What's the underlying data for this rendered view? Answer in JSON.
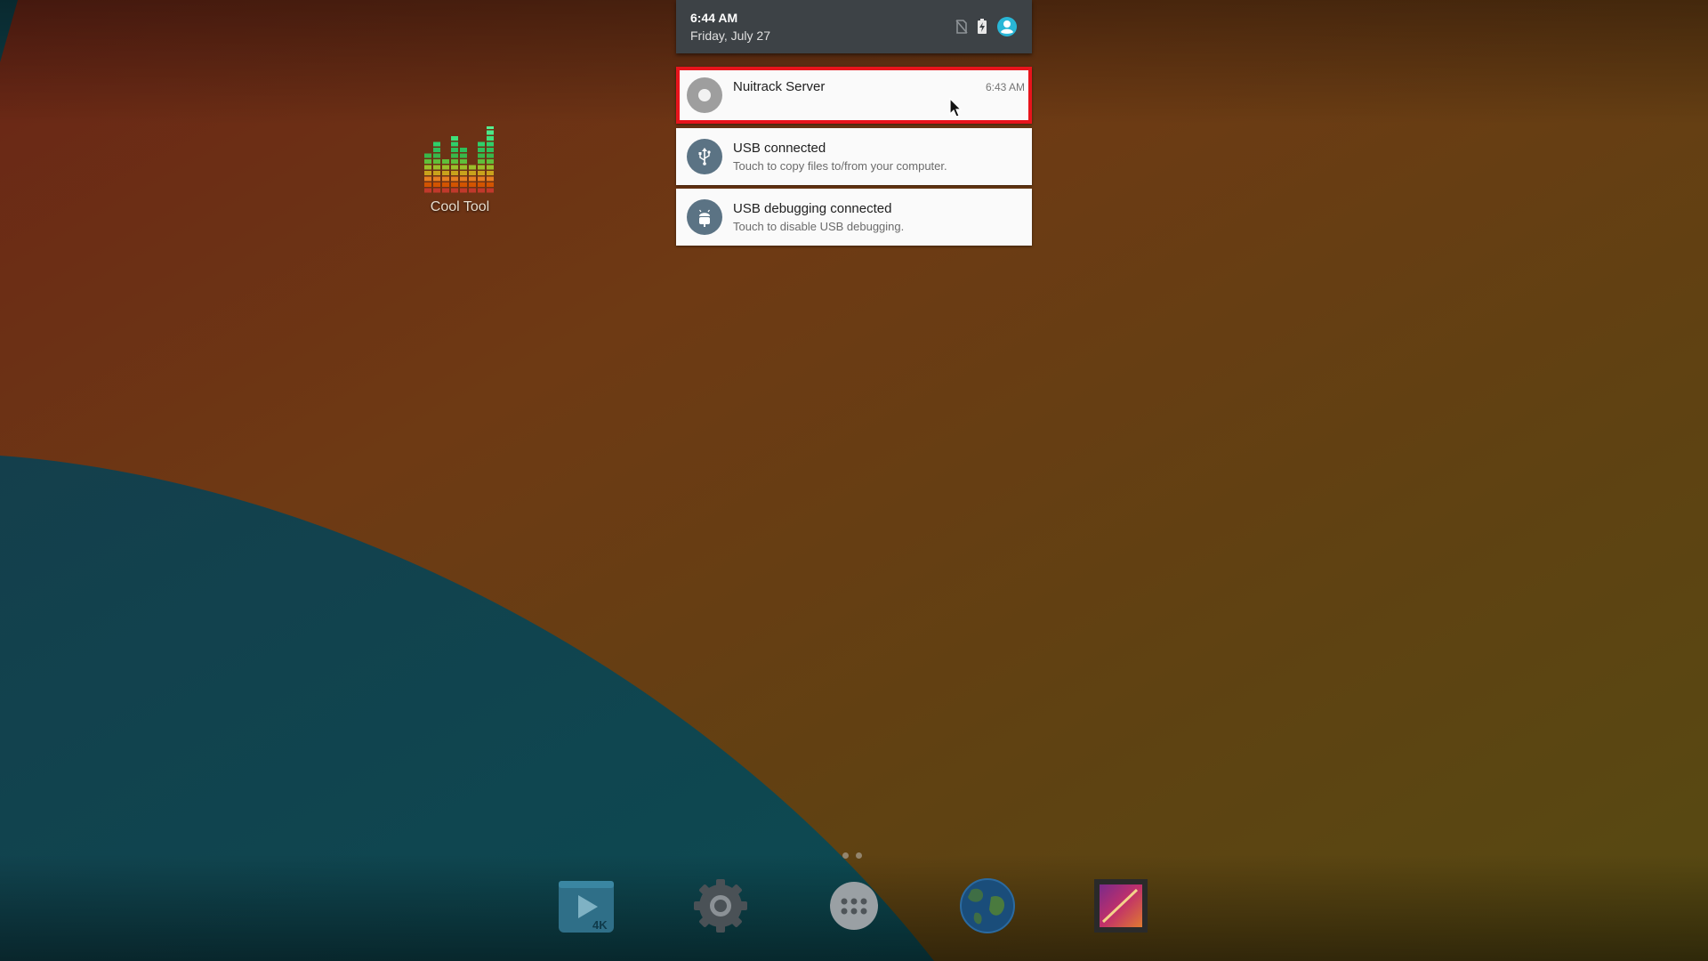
{
  "status": {
    "time": "6:44 AM",
    "date": "Friday, July 27",
    "icons": [
      "no-sim-icon",
      "battery-charging-icon",
      "user-account-icon"
    ]
  },
  "notifications": [
    {
      "title": "Nuitrack Server",
      "text": "",
      "time": "6:43 AM",
      "icon": "nuitrack-icon",
      "highlighted": true
    },
    {
      "title": "USB connected",
      "text": "Touch to copy files to/from your computer.",
      "time": "",
      "icon": "usb-icon"
    },
    {
      "title": "USB debugging connected",
      "text": "Touch to disable USB debugging.",
      "time": "",
      "icon": "android-debug-icon"
    }
  ],
  "desktop": {
    "shortcut": {
      "label": "Cool Tool",
      "icon": "equalizer-icon"
    }
  },
  "home": {
    "pages": 2,
    "current_page": 1
  },
  "dock": [
    {
      "name": "video-player-4k",
      "icon": "play-4k-icon",
      "badge": "4K"
    },
    {
      "name": "settings",
      "icon": "gear-icon"
    },
    {
      "name": "all-apps",
      "icon": "app-drawer-icon"
    },
    {
      "name": "browser",
      "icon": "globe-icon"
    },
    {
      "name": "gallery",
      "icon": "gallery-icon"
    }
  ],
  "colors": {
    "highlight": "#e8141c",
    "accent": "#29b6d6",
    "notification_bg": "#fafafa",
    "shade_header": "#3d4246",
    "icon_circle": "#5b7384"
  }
}
